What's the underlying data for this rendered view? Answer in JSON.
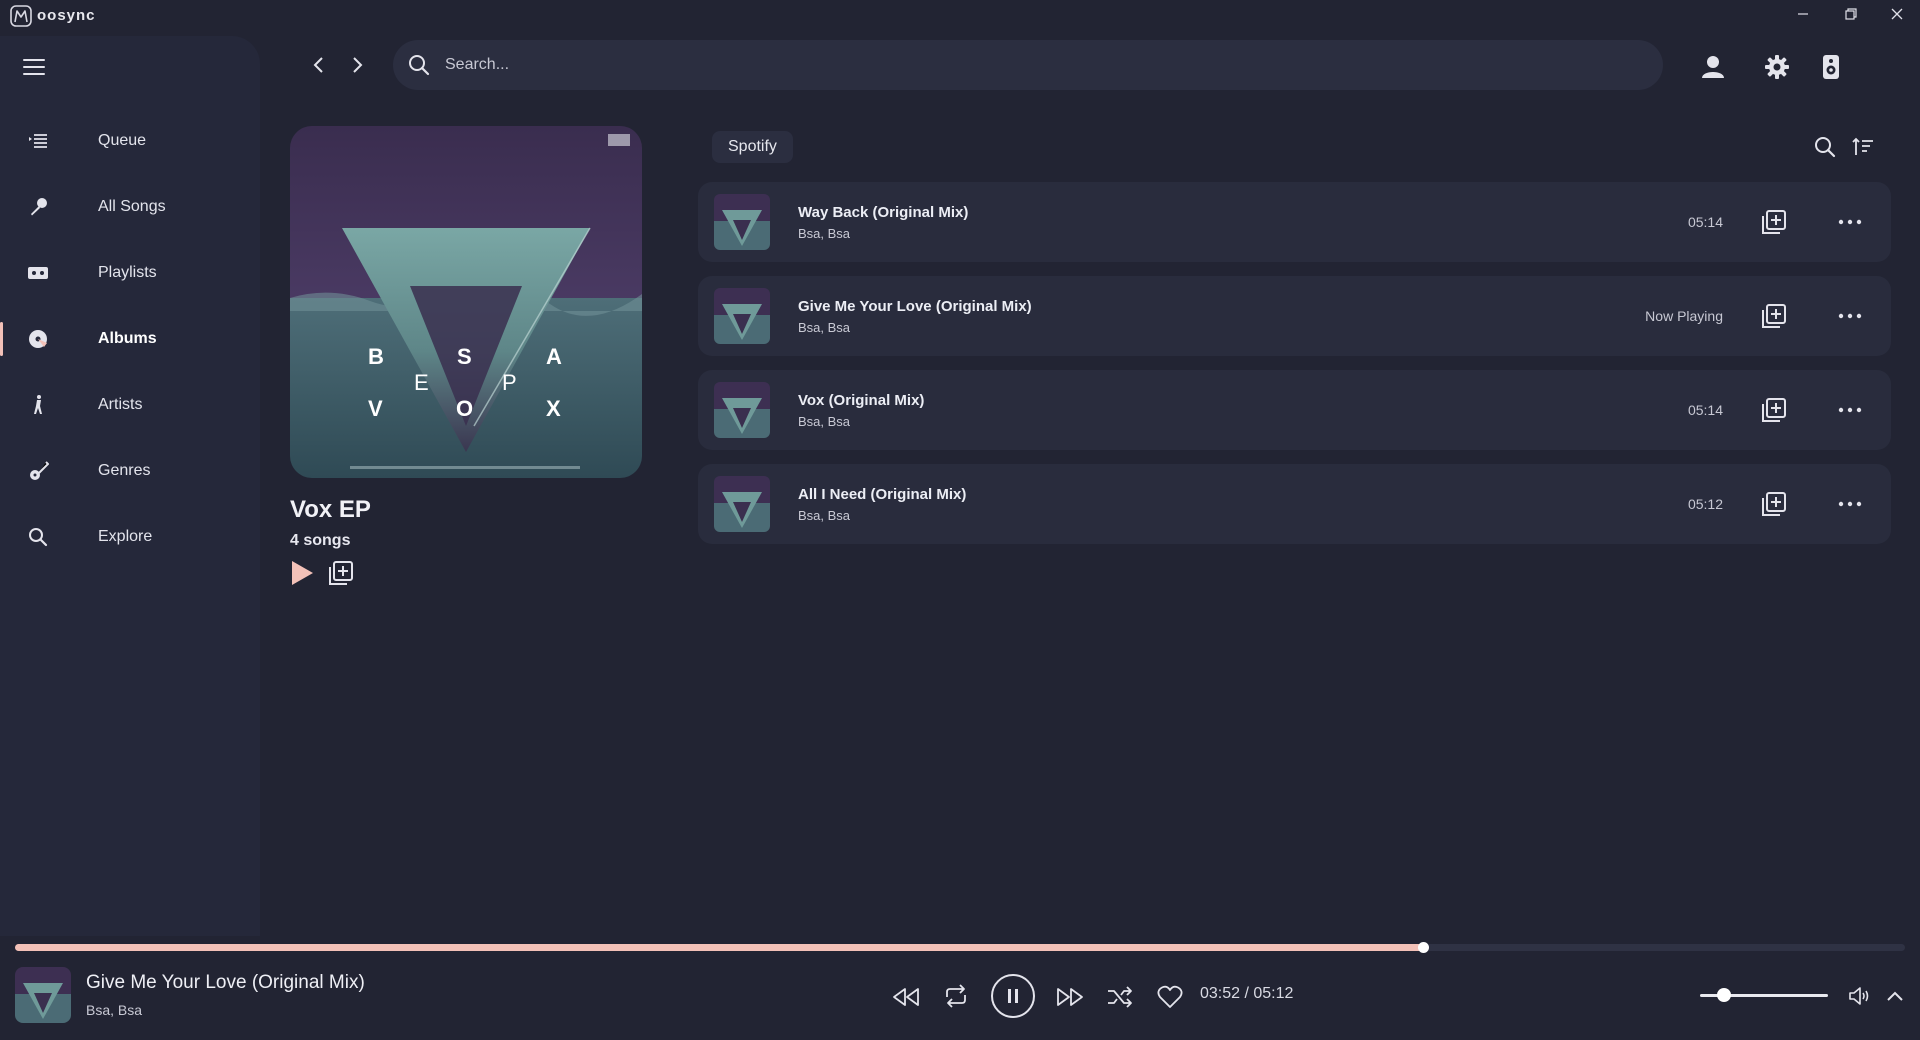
{
  "app": {
    "name": "oosync"
  },
  "sidebar": {
    "items": [
      {
        "label": "Queue",
        "icon": "queue-icon"
      },
      {
        "label": "All Songs",
        "icon": "microphone-icon"
      },
      {
        "label": "Playlists",
        "icon": "cassette-icon"
      },
      {
        "label": "Albums",
        "icon": "album-disc-icon",
        "active": true
      },
      {
        "label": "Artists",
        "icon": "artist-icon"
      },
      {
        "label": "Genres",
        "icon": "guitar-icon"
      },
      {
        "label": "Explore",
        "icon": "search-icon"
      }
    ]
  },
  "search": {
    "placeholder": "Search..."
  },
  "album": {
    "title": "Vox EP",
    "song_count": "4 songs",
    "cover_letters": {
      "top": [
        "B",
        "S",
        "A"
      ],
      "middle": [
        "E",
        "P"
      ],
      "bottom": [
        "V",
        "O",
        "X"
      ]
    }
  },
  "provider": {
    "label": "Spotify"
  },
  "tracks": [
    {
      "title": "Way Back (Original Mix)",
      "artist": "Bsa, Bsa",
      "meta": "05:14"
    },
    {
      "title": "Give Me Your Love (Original Mix)",
      "artist": "Bsa, Bsa",
      "meta": "Now Playing"
    },
    {
      "title": "Vox (Original Mix)",
      "artist": "Bsa, Bsa",
      "meta": "05:14"
    },
    {
      "title": "All I Need (Original Mix)",
      "artist": "Bsa, Bsa",
      "meta": "05:12"
    }
  ],
  "player": {
    "title": "Give Me Your Love (Original Mix)",
    "artist": "Bsa, Bsa",
    "time": "03:52 / 05:12",
    "progress_fraction": 0.745,
    "volume_fraction": 0.19,
    "state": "playing"
  },
  "colors": {
    "background": "#222433",
    "sidebar": "#25283a",
    "card": "#292c3d",
    "accent": "#f3c1b8"
  }
}
